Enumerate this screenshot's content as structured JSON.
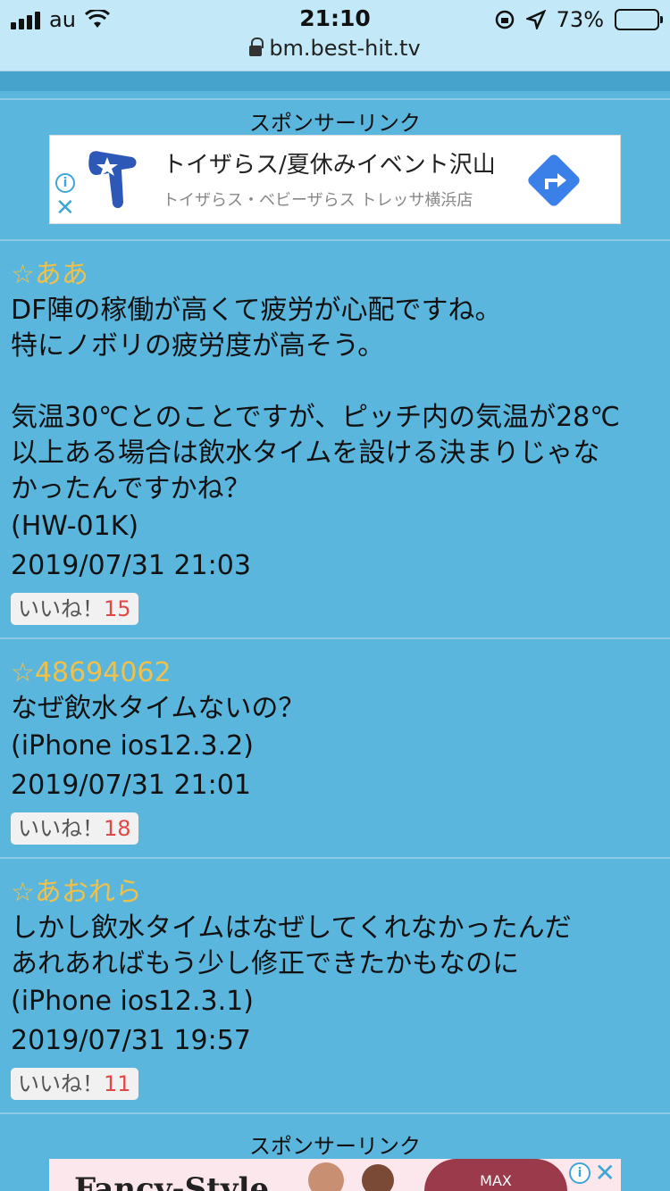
{
  "status_bar": {
    "carrier": "au",
    "time": "21:10",
    "battery_percent": "73%",
    "battery_level": 0.73,
    "url": "bm.best-hit.tv"
  },
  "sponsor_label": "スポンサーリンク",
  "ad1": {
    "title": "トイザらス/夏休みイベント沢山",
    "subtitle": "トイザらス・ベビーザらス トレッサ横浜店",
    "info_icon": "info-icon",
    "close_icon": "close-icon",
    "direction_icon": "directions-icon",
    "accent_color": "#3b7fe8"
  },
  "posts": [
    {
      "name": "☆ああ",
      "body": "DF陣の稼働が高くて疲労が心配ですね。\n特にノボリの疲労度が高そう。\n\n気温30℃とのことですが、ピッチ内の気温が28℃\n以上ある場合は飲水タイムを設ける決まりじゃな\nかったんですかね？",
      "device": "(HW-01K)",
      "datetime": "2019/07/31 21:03",
      "like_label": "いいね！",
      "like_count": "15"
    },
    {
      "name": "☆48694062",
      "body": "なぜ飲水タイムないの？",
      "device": "(iPhone ios12.3.2)",
      "datetime": "2019/07/31 21:01",
      "like_label": "いいね！",
      "like_count": "18"
    },
    {
      "name": "☆あおれら",
      "body": "しかし飲水タイムはなぜしてくれなかったんだ\nあれあればもう少し修正できたかもなのに",
      "device": "(iPhone ios12.3.1)",
      "datetime": "2019/07/31 19:57",
      "like_label": "いいね！",
      "like_count": "11"
    }
  ],
  "ad2": {
    "text": "Fancy-Style",
    "badge": "MAX"
  },
  "colors": {
    "background": "#5bb6de",
    "name_color": "#f0c14a",
    "like_count_color": "#e04848"
  }
}
